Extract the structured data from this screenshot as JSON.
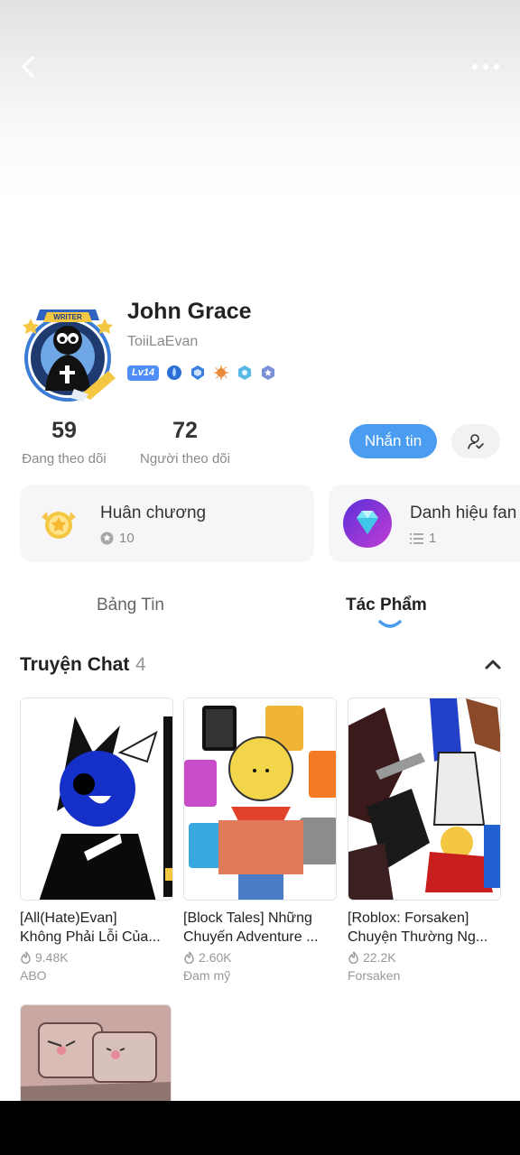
{
  "profile": {
    "name": "John Grace",
    "handle": "ToiiLaEvan",
    "avatar_banner": "WRITER",
    "level": "Lv14",
    "badge_icons": [
      "water-badge-icon",
      "shield-badge-icon",
      "sun-badge-icon",
      "ice-badge-icon",
      "star-badge-icon"
    ]
  },
  "stats": {
    "following_count": "59",
    "following_label": "Đang theo dõi",
    "followers_count": "72",
    "followers_label": "Người theo dõi"
  },
  "actions": {
    "message_label": "Nhắn tin"
  },
  "cards": {
    "medals_title": "Huân chương",
    "medals_count": "10",
    "fan_title": "Danh hiệu fan",
    "fan_count": "1"
  },
  "tabs": [
    {
      "label": "Bảng Tin",
      "active": false
    },
    {
      "label": "Tác Phẩm",
      "active": true
    }
  ],
  "section": {
    "title": "Truyện Chat",
    "count": "4"
  },
  "stories": [
    {
      "title_line1": "[All(Hate)Evan]",
      "title_line2": "Không Phải Lỗi Của...",
      "views": "9.48K",
      "category": "ABO"
    },
    {
      "title_line1": "[Block Tales] Những",
      "title_line2": "Chuyến Adventure ...",
      "views": "2.60K",
      "category": "Đam mỹ"
    },
    {
      "title_line1": "[Roblox: Forsaken]",
      "title_line2": "Chuyện Thường Ng...",
      "views": "22.2K",
      "category": "Forsaken"
    }
  ],
  "colors": {
    "accent": "#4a9df1",
    "text_primary": "#222222",
    "text_secondary": "#8a8a8a",
    "card_bg": "#f6f6f8"
  }
}
